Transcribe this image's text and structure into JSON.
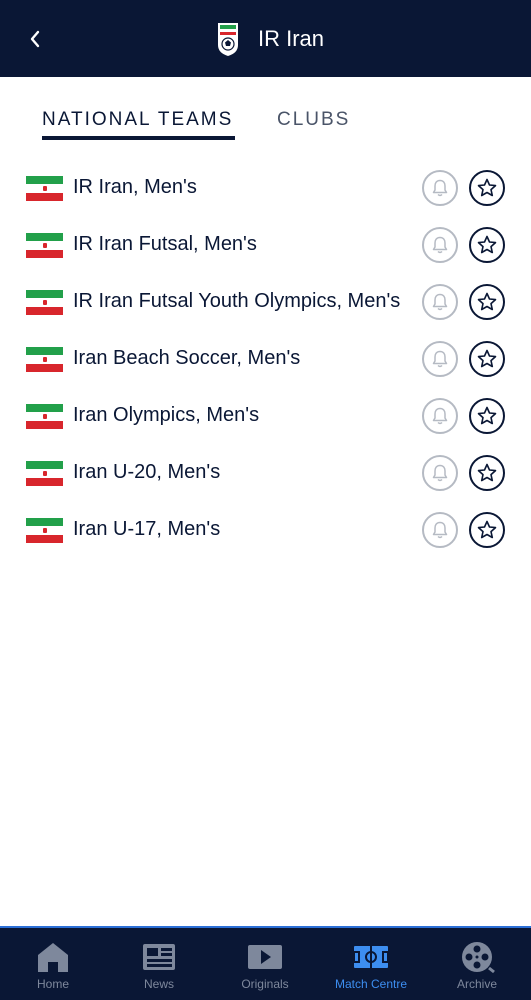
{
  "header": {
    "title": "IR Iran",
    "back_icon": "chevron-left-icon",
    "logo_icon": "federation-crest-icon"
  },
  "tabs": [
    {
      "label": "NATIONAL TEAMS",
      "active": true
    },
    {
      "label": "CLUBS",
      "active": false
    }
  ],
  "teams": [
    {
      "name": "IR Iran, Men's"
    },
    {
      "name": "IR Iran Futsal, Men's"
    },
    {
      "name": "IR Iran Futsal Youth Olympics, Men's"
    },
    {
      "name": "Iran Beach Soccer, Men's"
    },
    {
      "name": "Iran Olympics, Men's"
    },
    {
      "name": "Iran U-20, Men's"
    },
    {
      "name": "Iran U-17, Men's"
    }
  ],
  "row_icons": {
    "notify": "bell-icon",
    "favorite": "star-icon",
    "flag": "iran-flag-icon"
  },
  "bottom_nav": [
    {
      "label": "Home",
      "icon": "home-icon",
      "active": false
    },
    {
      "label": "News",
      "icon": "news-icon",
      "active": false
    },
    {
      "label": "Originals",
      "icon": "play-icon",
      "active": false
    },
    {
      "label": "Match Centre",
      "icon": "pitch-icon",
      "active": true
    },
    {
      "label": "Archive",
      "icon": "film-reel-icon",
      "active": false
    }
  ],
  "colors": {
    "navy": "#0a1735",
    "accent_blue": "#3d8ef0",
    "nav_inactive": "#7e889c",
    "bell_border": "#b5bac3",
    "flag_green": "#22a04a",
    "flag_red": "#d8262c"
  }
}
